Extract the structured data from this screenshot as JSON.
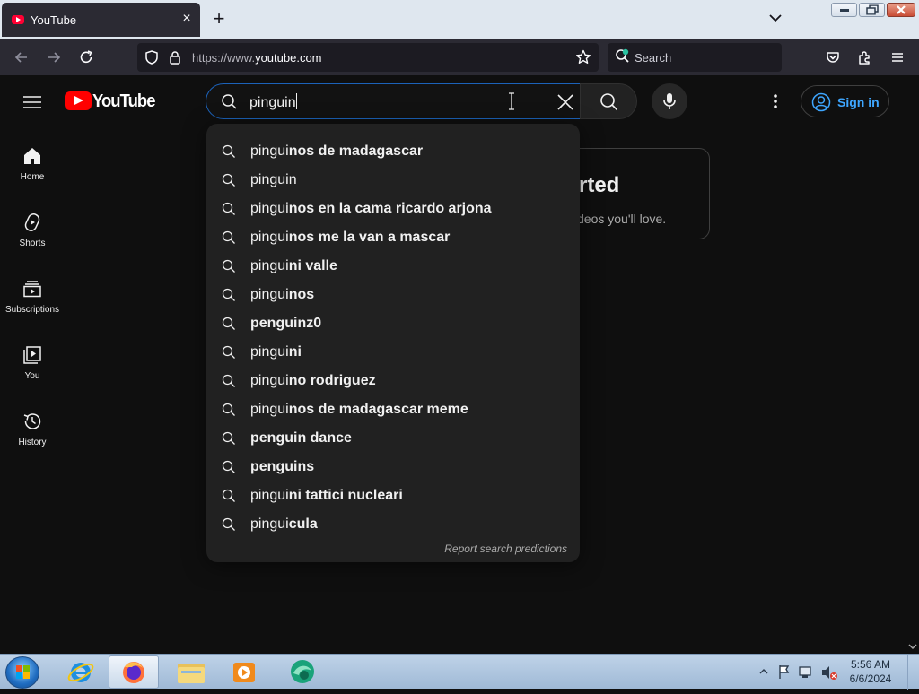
{
  "browser": {
    "tab": {
      "title": "YouTube",
      "close": "×"
    },
    "new_tab": "+",
    "url": {
      "prefix": "https://www.",
      "domain": "youtube.com"
    },
    "web_search_label": "Search"
  },
  "youtube": {
    "logo_text": "YouTube",
    "search": {
      "query": "pinguin"
    },
    "sign_in_label": "Sign in",
    "nav": [
      {
        "label": "Home",
        "icon": "home-icon"
      },
      {
        "label": "Shorts",
        "icon": "shorts-icon"
      },
      {
        "label": "Subscriptions",
        "icon": "subscriptions-icon"
      },
      {
        "label": "You",
        "icon": "you-icon"
      },
      {
        "label": "History",
        "icon": "history-icon"
      }
    ],
    "card": {
      "heading": "rted",
      "text": "deos you'll love."
    },
    "suggestions": [
      {
        "prefix": "pingui",
        "rest": "nos de madagascar"
      },
      {
        "prefix": "pinguin",
        "rest": ""
      },
      {
        "prefix": "pingui",
        "rest": "nos en la cama ricardo arjona"
      },
      {
        "prefix": "pingui",
        "rest": "nos me la van a mascar"
      },
      {
        "prefix": "pingui",
        "rest": "ni valle"
      },
      {
        "prefix": "pingui",
        "rest": "nos"
      },
      {
        "prefix": "",
        "rest": "penguinz0"
      },
      {
        "prefix": "pingui",
        "rest": "ni"
      },
      {
        "prefix": "pingui",
        "rest": "no rodriguez"
      },
      {
        "prefix": "pingui",
        "rest": "nos de madagascar meme"
      },
      {
        "prefix": "",
        "rest": "penguin dance"
      },
      {
        "prefix": "",
        "rest": "penguins"
      },
      {
        "prefix": "pingui",
        "rest": "ni tattici nucleari"
      },
      {
        "prefix": "pingui",
        "rest": "cula"
      }
    ],
    "report_label": "Report search predictions"
  },
  "taskbar": {
    "apps": [
      "internet-explorer-icon",
      "firefox-icon",
      "file-explorer-icon",
      "media-player-icon",
      "browser-app-icon"
    ],
    "clock": {
      "time": "5:56 AM",
      "date": "6/6/2024"
    }
  },
  "colors": {
    "accent_blue": "#3ea6ff",
    "youtube_red": "#ff0000",
    "search_focus": "#1c62b9"
  }
}
